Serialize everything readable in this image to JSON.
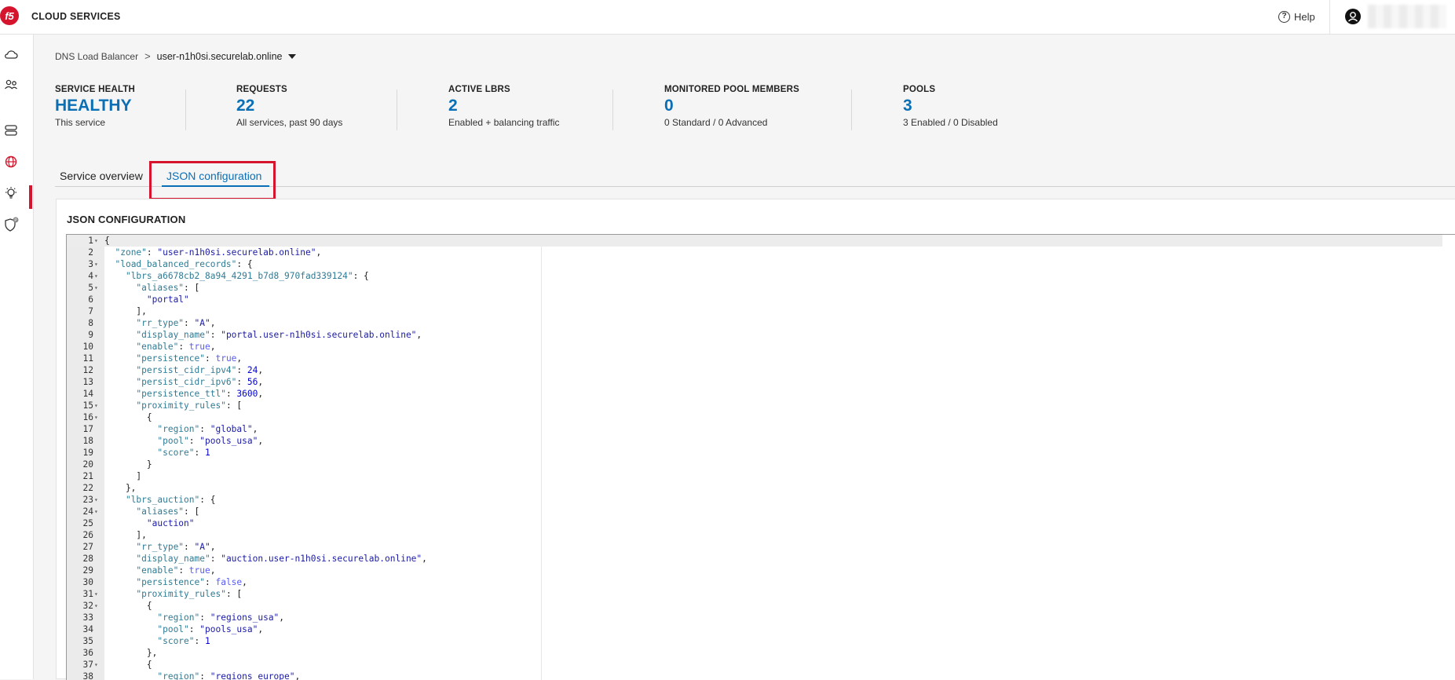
{
  "header": {
    "app_title": "CLOUD SERVICES",
    "help_label": "Help",
    "help_glyph": "?",
    "logo_text": "f5",
    "brand_color": "#d5152d"
  },
  "rail": {
    "items": [
      "cloud-icon",
      "users-icon",
      "servers-icon",
      "globe-icon",
      "bulb-icon",
      "shield-icon"
    ],
    "active": "globe-icon",
    "shield_badge": "P"
  },
  "breadcrumb": {
    "parent": "DNS Load Balancer",
    "separator": ">",
    "current": "user-n1h0si.securelab.online"
  },
  "stats": [
    {
      "label": "SERVICE HEALTH",
      "value": "HEALTHY",
      "sub": "This service"
    },
    {
      "label": "REQUESTS",
      "value": "22",
      "sub": "All services, past 90 days"
    },
    {
      "label": "ACTIVE LBRS",
      "value": "2",
      "sub": "Enabled + balancing traffic"
    },
    {
      "label": "MONITORED POOL MEMBERS",
      "value": "0",
      "sub": "0 Standard / 0 Advanced"
    },
    {
      "label": "POOLS",
      "value": "3",
      "sub": "3 Enabled / 0 Disabled"
    }
  ],
  "tabs": {
    "overview": "Service overview",
    "json": "JSON configuration",
    "active": "json"
  },
  "panel": {
    "title": "JSON CONFIGURATION"
  },
  "editor": {
    "lines": [
      {
        "n": "1",
        "fold": true,
        "code": [
          [
            "p",
            "{"
          ]
        ]
      },
      {
        "n": "2",
        "fold": false,
        "code": [
          [
            "p",
            "  "
          ],
          [
            "k",
            "\"zone\""
          ],
          [
            "p",
            ": "
          ],
          [
            "s",
            "\"user-n1h0si.securelab.online\""
          ],
          [
            "p",
            ","
          ]
        ]
      },
      {
        "n": "3",
        "fold": true,
        "code": [
          [
            "p",
            "  "
          ],
          [
            "k",
            "\"load_balanced_records\""
          ],
          [
            "p",
            ": {"
          ]
        ]
      },
      {
        "n": "4",
        "fold": true,
        "code": [
          [
            "p",
            "    "
          ],
          [
            "k",
            "\"lbrs_a6678cb2_8a94_4291_b7d8_970fad339124\""
          ],
          [
            "p",
            ": {"
          ]
        ]
      },
      {
        "n": "5",
        "fold": true,
        "code": [
          [
            "p",
            "      "
          ],
          [
            "k",
            "\"aliases\""
          ],
          [
            "p",
            ": ["
          ]
        ]
      },
      {
        "n": "6",
        "fold": false,
        "code": [
          [
            "p",
            "        "
          ],
          [
            "s",
            "\"portal\""
          ]
        ]
      },
      {
        "n": "7",
        "fold": false,
        "code": [
          [
            "p",
            "      ],"
          ]
        ]
      },
      {
        "n": "8",
        "fold": false,
        "code": [
          [
            "p",
            "      "
          ],
          [
            "k",
            "\"rr_type\""
          ],
          [
            "p",
            ": "
          ],
          [
            "s",
            "\"A\""
          ],
          [
            "p",
            ","
          ]
        ]
      },
      {
        "n": "9",
        "fold": false,
        "code": [
          [
            "p",
            "      "
          ],
          [
            "k",
            "\"display_name\""
          ],
          [
            "p",
            ": "
          ],
          [
            "s",
            "\"portal.user-n1h0si.securelab.online\""
          ],
          [
            "p",
            ","
          ]
        ]
      },
      {
        "n": "10",
        "fold": false,
        "code": [
          [
            "p",
            "      "
          ],
          [
            "k",
            "\"enable\""
          ],
          [
            "p",
            ": "
          ],
          [
            "b",
            "true"
          ],
          [
            "p",
            ","
          ]
        ]
      },
      {
        "n": "11",
        "fold": false,
        "code": [
          [
            "p",
            "      "
          ],
          [
            "k",
            "\"persistence\""
          ],
          [
            "p",
            ": "
          ],
          [
            "b",
            "true"
          ],
          [
            "p",
            ","
          ]
        ]
      },
      {
        "n": "12",
        "fold": false,
        "code": [
          [
            "p",
            "      "
          ],
          [
            "k",
            "\"persist_cidr_ipv4\""
          ],
          [
            "p",
            ": "
          ],
          [
            "n",
            "24"
          ],
          [
            "p",
            ","
          ]
        ]
      },
      {
        "n": "13",
        "fold": false,
        "code": [
          [
            "p",
            "      "
          ],
          [
            "k",
            "\"persist_cidr_ipv6\""
          ],
          [
            "p",
            ": "
          ],
          [
            "n",
            "56"
          ],
          [
            "p",
            ","
          ]
        ]
      },
      {
        "n": "14",
        "fold": false,
        "code": [
          [
            "p",
            "      "
          ],
          [
            "k",
            "\"persistence_ttl\""
          ],
          [
            "p",
            ": "
          ],
          [
            "n",
            "3600"
          ],
          [
            "p",
            ","
          ]
        ]
      },
      {
        "n": "15",
        "fold": true,
        "code": [
          [
            "p",
            "      "
          ],
          [
            "k",
            "\"proximity_rules\""
          ],
          [
            "p",
            ": ["
          ]
        ]
      },
      {
        "n": "16",
        "fold": true,
        "code": [
          [
            "p",
            "        {"
          ]
        ]
      },
      {
        "n": "17",
        "fold": false,
        "code": [
          [
            "p",
            "          "
          ],
          [
            "k",
            "\"region\""
          ],
          [
            "p",
            ": "
          ],
          [
            "s",
            "\"global\""
          ],
          [
            "p",
            ","
          ]
        ]
      },
      {
        "n": "18",
        "fold": false,
        "code": [
          [
            "p",
            "          "
          ],
          [
            "k",
            "\"pool\""
          ],
          [
            "p",
            ": "
          ],
          [
            "s",
            "\"pools_usa\""
          ],
          [
            "p",
            ","
          ]
        ]
      },
      {
        "n": "19",
        "fold": false,
        "code": [
          [
            "p",
            "          "
          ],
          [
            "k",
            "\"score\""
          ],
          [
            "p",
            ": "
          ],
          [
            "n",
            "1"
          ]
        ]
      },
      {
        "n": "20",
        "fold": false,
        "code": [
          [
            "p",
            "        }"
          ]
        ]
      },
      {
        "n": "21",
        "fold": false,
        "code": [
          [
            "p",
            "      ]"
          ]
        ]
      },
      {
        "n": "22",
        "fold": false,
        "code": [
          [
            "p",
            "    },"
          ]
        ]
      },
      {
        "n": "23",
        "fold": true,
        "code": [
          [
            "p",
            "    "
          ],
          [
            "k",
            "\"lbrs_auction\""
          ],
          [
            "p",
            ": {"
          ]
        ]
      },
      {
        "n": "24",
        "fold": true,
        "code": [
          [
            "p",
            "      "
          ],
          [
            "k",
            "\"aliases\""
          ],
          [
            "p",
            ": ["
          ]
        ]
      },
      {
        "n": "25",
        "fold": false,
        "code": [
          [
            "p",
            "        "
          ],
          [
            "s",
            "\"auction\""
          ]
        ]
      },
      {
        "n": "26",
        "fold": false,
        "code": [
          [
            "p",
            "      ],"
          ]
        ]
      },
      {
        "n": "27",
        "fold": false,
        "code": [
          [
            "p",
            "      "
          ],
          [
            "k",
            "\"rr_type\""
          ],
          [
            "p",
            ": "
          ],
          [
            "s",
            "\"A\""
          ],
          [
            "p",
            ","
          ]
        ]
      },
      {
        "n": "28",
        "fold": false,
        "code": [
          [
            "p",
            "      "
          ],
          [
            "k",
            "\"display_name\""
          ],
          [
            "p",
            ": "
          ],
          [
            "s",
            "\"auction.user-n1h0si.securelab.online\""
          ],
          [
            "p",
            ","
          ]
        ]
      },
      {
        "n": "29",
        "fold": false,
        "code": [
          [
            "p",
            "      "
          ],
          [
            "k",
            "\"enable\""
          ],
          [
            "p",
            ": "
          ],
          [
            "b",
            "true"
          ],
          [
            "p",
            ","
          ]
        ]
      },
      {
        "n": "30",
        "fold": false,
        "code": [
          [
            "p",
            "      "
          ],
          [
            "k",
            "\"persistence\""
          ],
          [
            "p",
            ": "
          ],
          [
            "b",
            "false"
          ],
          [
            "p",
            ","
          ]
        ]
      },
      {
        "n": "31",
        "fold": true,
        "code": [
          [
            "p",
            "      "
          ],
          [
            "k",
            "\"proximity_rules\""
          ],
          [
            "p",
            ": ["
          ]
        ]
      },
      {
        "n": "32",
        "fold": true,
        "code": [
          [
            "p",
            "        {"
          ]
        ]
      },
      {
        "n": "33",
        "fold": false,
        "code": [
          [
            "p",
            "          "
          ],
          [
            "k",
            "\"region\""
          ],
          [
            "p",
            ": "
          ],
          [
            "s",
            "\"regions_usa\""
          ],
          [
            "p",
            ","
          ]
        ]
      },
      {
        "n": "34",
        "fold": false,
        "code": [
          [
            "p",
            "          "
          ],
          [
            "k",
            "\"pool\""
          ],
          [
            "p",
            ": "
          ],
          [
            "s",
            "\"pools_usa\""
          ],
          [
            "p",
            ","
          ]
        ]
      },
      {
        "n": "35",
        "fold": false,
        "code": [
          [
            "p",
            "          "
          ],
          [
            "k",
            "\"score\""
          ],
          [
            "p",
            ": "
          ],
          [
            "n",
            "1"
          ]
        ]
      },
      {
        "n": "36",
        "fold": false,
        "code": [
          [
            "p",
            "        },"
          ]
        ]
      },
      {
        "n": "37",
        "fold": true,
        "code": [
          [
            "p",
            "        {"
          ]
        ]
      },
      {
        "n": "38",
        "fold": false,
        "code": [
          [
            "p",
            "          "
          ],
          [
            "k",
            "\"region\""
          ],
          [
            "p",
            ": "
          ],
          [
            "s",
            "\"regions_europe\""
          ],
          [
            "p",
            ","
          ]
        ]
      }
    ],
    "active_line": "1",
    "fold_glyph": "▾"
  }
}
